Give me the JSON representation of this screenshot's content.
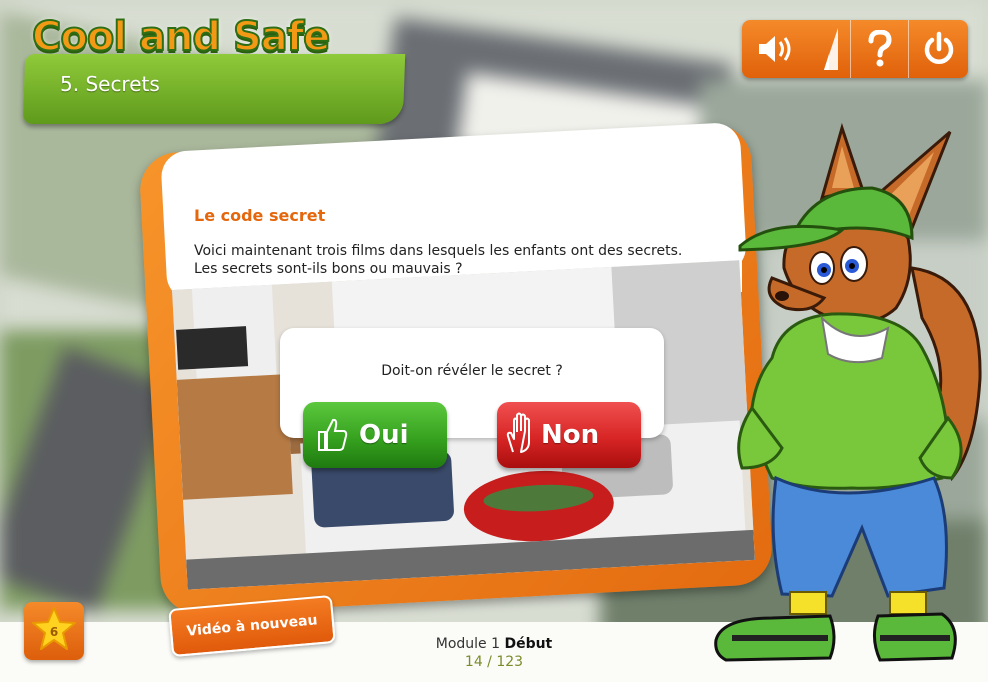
{
  "header": {
    "app_title": "Cool and Safe",
    "chapter_title": "5. Secrets"
  },
  "controls": {
    "sound_icon": "speaker-volume-icon",
    "volume_icon": "volume-level-icon",
    "help_icon": "question-icon",
    "power_icon": "power-icon"
  },
  "card": {
    "heading": "Le code secret",
    "text_line1": "Voici maintenant trois films dans lesquels les enfants ont des secrets.",
    "text_line2": "Les secrets sont-ils bons ou mauvais ?"
  },
  "dialog": {
    "question": "Doit-on révéler le secret ?",
    "yes_label": "Oui",
    "no_label": "Non",
    "yes_icon": "thumbs-up-icon",
    "no_icon": "stop-hand-icon"
  },
  "footer": {
    "stars": "6",
    "replay_label": "Vidéo à nouveau",
    "module_label": "Module 1",
    "module_part": "Début",
    "page_counter": "14 / 123"
  },
  "colors": {
    "accent_orange": "#e9700f",
    "title_green": "#6da82a",
    "yes_green": "#36a21f",
    "no_red": "#d82525"
  }
}
